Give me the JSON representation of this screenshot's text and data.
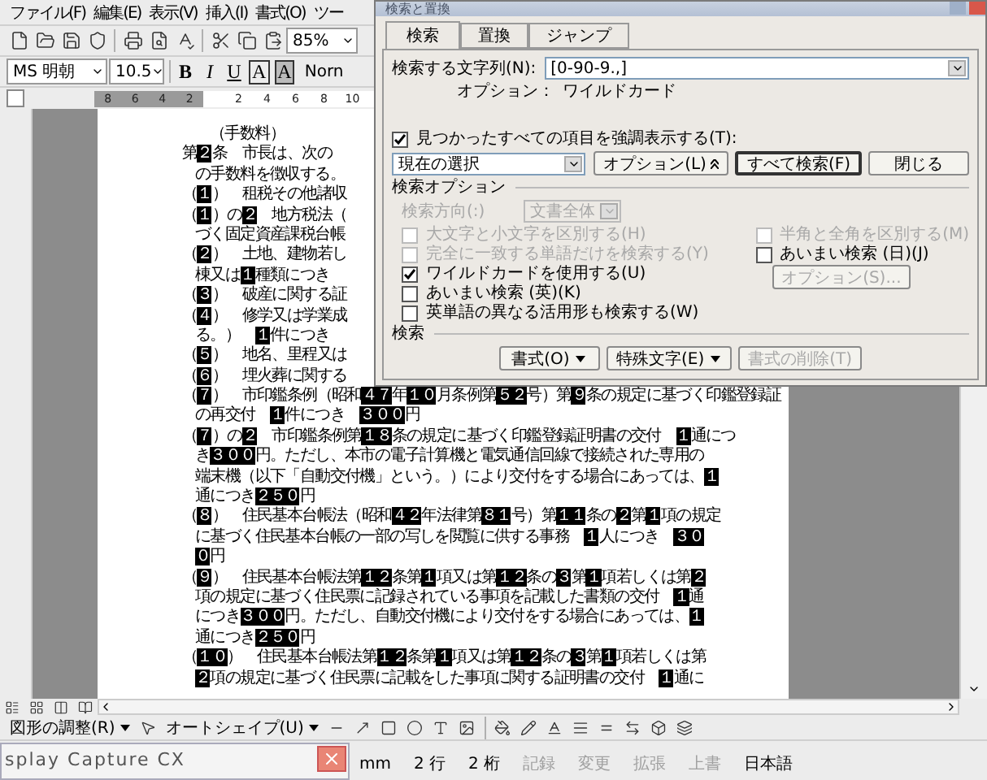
{
  "menu_bar": {
    "items": [
      "ファイル(F)",
      "編集(E)",
      "表示(V)",
      "挿入(I)",
      "書式(O)",
      "ツー"
    ]
  },
  "standard_toolbar": {
    "zoom": "85%"
  },
  "formatting_toolbar": {
    "font": "MS 明朝",
    "size": "10.5",
    "buttons": [
      {
        "kind": "bold",
        "label": "B"
      },
      {
        "kind": "italic",
        "label": "I"
      },
      {
        "kind": "underline",
        "label": "U"
      },
      {
        "kind": "border",
        "label": "A"
      },
      {
        "kind": "shading",
        "label": "A"
      }
    ],
    "style": "Norn"
  },
  "ruler": {
    "left_labels": [
      "8",
      "6",
      "4",
      "2"
    ],
    "right_labels": [
      "2",
      "4",
      "6",
      "8",
      "10"
    ]
  },
  "document": {
    "lines": [
      {
        "kind": "heading",
        "segments": [
          {
            "text": "（手数料）",
            "highlighted": false
          }
        ]
      },
      {
        "kind": "item",
        "segments": [
          {
            "text": "第",
            "highlighted": false
          },
          {
            "text": "２",
            "highlighted": true
          },
          {
            "text": "条　市長は、次の",
            "highlighted": false
          }
        ]
      },
      {
        "kind": "continuation",
        "segments": [
          {
            "text": "の手数料を徴収する。",
            "highlighted": false
          }
        ]
      },
      {
        "kind": "item",
        "segments": [
          {
            "text": "（",
            "highlighted": false
          },
          {
            "text": "１",
            "highlighted": true
          },
          {
            "text": "）　租税その他諸収",
            "highlighted": false
          }
        ]
      },
      {
        "kind": "item",
        "segments": [
          {
            "text": "（",
            "highlighted": false
          },
          {
            "text": "１",
            "highlighted": true
          },
          {
            "text": "）の",
            "highlighted": false
          },
          {
            "text": "２",
            "highlighted": true
          },
          {
            "text": "　地方税法（",
            "highlighted": false
          }
        ]
      },
      {
        "kind": "continuation",
        "segments": [
          {
            "text": "づく固定資産課税台帳",
            "highlighted": false
          }
        ]
      },
      {
        "kind": "item",
        "segments": [
          {
            "text": "（",
            "highlighted": false
          },
          {
            "text": "２",
            "highlighted": true
          },
          {
            "text": "）　土地、建物若し",
            "highlighted": false
          }
        ]
      },
      {
        "kind": "continuation",
        "segments": [
          {
            "text": "棟又は",
            "highlighted": false
          },
          {
            "text": "１",
            "highlighted": true
          },
          {
            "text": "種類につき",
            "highlighted": false
          }
        ]
      },
      {
        "kind": "item",
        "segments": [
          {
            "text": "（",
            "highlighted": false
          },
          {
            "text": "３",
            "highlighted": true
          },
          {
            "text": "）　破産に関する証",
            "highlighted": false
          }
        ]
      },
      {
        "kind": "item",
        "segments": [
          {
            "text": "（",
            "highlighted": false
          },
          {
            "text": "４",
            "highlighted": true
          },
          {
            "text": "）　修学又は学業成",
            "highlighted": false
          }
        ]
      },
      {
        "kind": "continuation",
        "segments": [
          {
            "text": "る。）　",
            "highlighted": false
          },
          {
            "text": "１",
            "highlighted": true
          },
          {
            "text": "件につき",
            "highlighted": false
          }
        ]
      },
      {
        "kind": "item",
        "segments": [
          {
            "text": "（",
            "highlighted": false
          },
          {
            "text": "５",
            "highlighted": true
          },
          {
            "text": "）　地名、里程又は",
            "highlighted": false
          }
        ]
      },
      {
        "kind": "item",
        "segments": [
          {
            "text": "（",
            "highlighted": false
          },
          {
            "text": "６",
            "highlighted": true
          },
          {
            "text": "）　埋火葬に関する",
            "highlighted": false
          }
        ]
      },
      {
        "kind": "item",
        "segments": [
          {
            "text": "（",
            "highlighted": false
          },
          {
            "text": "７",
            "highlighted": true
          },
          {
            "text": "）　市印鑑条例（昭和",
            "highlighted": false
          },
          {
            "text": "４７",
            "highlighted": true
          },
          {
            "text": "年",
            "highlighted": false
          },
          {
            "text": "１０",
            "highlighted": true
          },
          {
            "text": "月条例第",
            "highlighted": false
          },
          {
            "text": "５２",
            "highlighted": true
          },
          {
            "text": "号）第",
            "highlighted": false
          },
          {
            "text": "９",
            "highlighted": true
          },
          {
            "text": "条の規定に基づく印鑑登録証",
            "highlighted": false
          }
        ]
      },
      {
        "kind": "continuation",
        "segments": [
          {
            "text": "の再交付　",
            "highlighted": false
          },
          {
            "text": "１",
            "highlighted": true
          },
          {
            "text": "件につき　",
            "highlighted": false
          },
          {
            "text": "３００",
            "highlighted": true
          },
          {
            "text": "円",
            "highlighted": false
          }
        ]
      },
      {
        "kind": "item",
        "segments": [
          {
            "text": "（",
            "highlighted": false
          },
          {
            "text": "７",
            "highlighted": true
          },
          {
            "text": "）の",
            "highlighted": false
          },
          {
            "text": "２",
            "highlighted": true
          },
          {
            "text": "　市印鑑条例第",
            "highlighted": false
          },
          {
            "text": "１８",
            "highlighted": true
          },
          {
            "text": "条の規定に基づく印鑑登録証明書の交付　",
            "highlighted": false
          },
          {
            "text": "１",
            "highlighted": true
          },
          {
            "text": "通につ",
            "highlighted": false
          }
        ]
      },
      {
        "kind": "continuation",
        "segments": [
          {
            "text": "き",
            "highlighted": false
          },
          {
            "text": "３００",
            "highlighted": true
          },
          {
            "text": "円。ただし、本市の電子計算機と電気通信回線で接続された専用の",
            "highlighted": false
          }
        ]
      },
      {
        "kind": "continuation",
        "segments": [
          {
            "text": "端末機（以下「自動交付機」という。）により交付をする場合にあっては、",
            "highlighted": false
          },
          {
            "text": "１",
            "highlighted": true
          }
        ]
      },
      {
        "kind": "continuation",
        "segments": [
          {
            "text": "通につき",
            "highlighted": false
          },
          {
            "text": "２５０",
            "highlighted": true
          },
          {
            "text": "円",
            "highlighted": false
          }
        ]
      },
      {
        "kind": "item",
        "segments": [
          {
            "text": "（",
            "highlighted": false
          },
          {
            "text": "８",
            "highlighted": true
          },
          {
            "text": "）　住民基本台帳法（昭和",
            "highlighted": false
          },
          {
            "text": "４２",
            "highlighted": true
          },
          {
            "text": "年法律第",
            "highlighted": false
          },
          {
            "text": "８１",
            "highlighted": true
          },
          {
            "text": "号）第",
            "highlighted": false
          },
          {
            "text": "１１",
            "highlighted": true
          },
          {
            "text": "条の",
            "highlighted": false
          },
          {
            "text": "２",
            "highlighted": true
          },
          {
            "text": "第",
            "highlighted": false
          },
          {
            "text": "１",
            "highlighted": true
          },
          {
            "text": "項の規定",
            "highlighted": false
          }
        ]
      },
      {
        "kind": "continuation",
        "segments": [
          {
            "text": "に基づく住民基本台帳の一部の写しを閲覧に供する事務　",
            "highlighted": false
          },
          {
            "text": "１",
            "highlighted": true
          },
          {
            "text": "人につき　",
            "highlighted": false
          },
          {
            "text": "３０",
            "highlighted": true
          }
        ]
      },
      {
        "kind": "continuation",
        "segments": [
          {
            "text": "０",
            "highlighted": true
          },
          {
            "text": "円",
            "highlighted": false
          }
        ]
      },
      {
        "kind": "item",
        "segments": [
          {
            "text": "（",
            "highlighted": false
          },
          {
            "text": "９",
            "highlighted": true
          },
          {
            "text": "）　住民基本台帳法第",
            "highlighted": false
          },
          {
            "text": "１２",
            "highlighted": true
          },
          {
            "text": "条第",
            "highlighted": false
          },
          {
            "text": "１",
            "highlighted": true
          },
          {
            "text": "項又は第",
            "highlighted": false
          },
          {
            "text": "１２",
            "highlighted": true
          },
          {
            "text": "条の",
            "highlighted": false
          },
          {
            "text": "３",
            "highlighted": true
          },
          {
            "text": "第",
            "highlighted": false
          },
          {
            "text": "１",
            "highlighted": true
          },
          {
            "text": "項若しくは第",
            "highlighted": false
          },
          {
            "text": "２",
            "highlighted": true
          }
        ]
      },
      {
        "kind": "continuation",
        "segments": [
          {
            "text": "項の規定に基づく住民票に記録されている事項を記載した書類の交付　",
            "highlighted": false
          },
          {
            "text": "１",
            "highlighted": true
          },
          {
            "text": "通",
            "highlighted": false
          }
        ]
      },
      {
        "kind": "continuation",
        "segments": [
          {
            "text": "につき",
            "highlighted": false
          },
          {
            "text": "３００",
            "highlighted": true
          },
          {
            "text": "円。ただし、自動交付機により交付をする場合にあっては、",
            "highlighted": false
          },
          {
            "text": "１",
            "highlighted": true
          }
        ]
      },
      {
        "kind": "continuation",
        "segments": [
          {
            "text": "通につき",
            "highlighted": false
          },
          {
            "text": "２５０",
            "highlighted": true
          },
          {
            "text": "円",
            "highlighted": false
          }
        ]
      },
      {
        "kind": "item",
        "segments": [
          {
            "text": "（",
            "highlighted": false
          },
          {
            "text": "１０",
            "highlighted": true
          },
          {
            "text": "）　住民基本台帳法第",
            "highlighted": false
          },
          {
            "text": "１２",
            "highlighted": true
          },
          {
            "text": "条第",
            "highlighted": false
          },
          {
            "text": "１",
            "highlighted": true
          },
          {
            "text": "項又は第",
            "highlighted": false
          },
          {
            "text": "１２",
            "highlighted": true
          },
          {
            "text": "条の",
            "highlighted": false
          },
          {
            "text": "３",
            "highlighted": true
          },
          {
            "text": "第",
            "highlighted": false
          },
          {
            "text": "１",
            "highlighted": true
          },
          {
            "text": "項若しくは第",
            "highlighted": false
          }
        ]
      },
      {
        "kind": "continuation",
        "segments": [
          {
            "text": "２",
            "highlighted": true
          },
          {
            "text": "項の規定に基づく住民票に記載をした事項に関する証明書の交付　",
            "highlighted": false
          },
          {
            "text": "１",
            "highlighted": true
          },
          {
            "text": "通に",
            "highlighted": false
          }
        ]
      }
    ]
  },
  "find_dialog": {
    "title": "検索と置換",
    "tabs": [
      {
        "label": "検索",
        "selected": true
      },
      {
        "label": "置換",
        "selected": false
      },
      {
        "label": "ジャンプ",
        "selected": false
      }
    ],
    "search_label": "検索する文字列(N):",
    "search_value": "[0-90-9.,]",
    "options_label": "オプション：",
    "options_value": "ワイルドカード",
    "highlight_all": {
      "label": "見つかったすべての項目を強調表示する(T):",
      "checked": true
    },
    "scope": "現在の選択",
    "buttons": [
      {
        "label": "オプション(L)",
        "default": false,
        "disabled": false
      },
      {
        "label": "すべて検索(F)",
        "default": true,
        "disabled": false
      },
      {
        "label": "閉じる",
        "default": false,
        "disabled": false
      }
    ],
    "search_options_heading": "検索オプション",
    "direction_label": "検索方向(:)",
    "direction_value": "文書全体",
    "direction_disabled": true,
    "left_options": [
      {
        "label": "大文字と小文字を区別する(H)",
        "checked": false,
        "disabled": true
      },
      {
        "label": "完全に一致する単語だけを検索する(Y)",
        "checked": false,
        "disabled": true
      },
      {
        "label": "ワイルドカードを使用する(U)",
        "checked": true,
        "disabled": false
      },
      {
        "label": "あいまい検索 (英)(K)",
        "checked": false,
        "disabled": false
      },
      {
        "label": "英単語の異なる活用形も検索する(W)",
        "checked": false,
        "disabled": false
      }
    ],
    "right_options": [
      {
        "label": "半角と全角を区別する(M)",
        "checked": false,
        "disabled": true
      },
      {
        "label": "あいまい検索 (日)(J)",
        "checked": false,
        "disabled": false
      }
    ],
    "fuzzy_options_button": {
      "label": "オプション(S)...",
      "disabled": true
    },
    "search_heading": "検索",
    "bottom_buttons": [
      {
        "label": "書式(O)",
        "dropdown": true,
        "disabled": false
      },
      {
        "label": "特殊文字(E)",
        "dropdown": true,
        "disabled": false
      },
      {
        "label": "書式の削除(T)",
        "dropdown": false,
        "disabled": true
      }
    ]
  },
  "drawing_toolbar": {
    "draw_menu": "図形の調整(R)",
    "autoshapes_menu": "オートシェイプ(U)"
  },
  "status_bar": {
    "items": [
      {
        "text": "mm",
        "disabled": false
      },
      {
        "text": "2 行",
        "disabled": false
      },
      {
        "text": "2 桁",
        "disabled": false
      },
      {
        "text": "記録",
        "disabled": true
      },
      {
        "text": "変更",
        "disabled": true
      },
      {
        "text": "拡張",
        "disabled": true
      },
      {
        "text": "上書",
        "disabled": true
      },
      {
        "text": "日本語",
        "disabled": false
      }
    ]
  },
  "capture_window": {
    "title": "splay Capture CX"
  }
}
